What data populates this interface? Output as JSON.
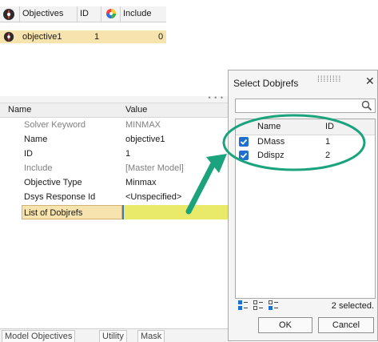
{
  "objectives_table": {
    "headers": [
      "Objectives",
      "ID",
      "Include"
    ],
    "row": {
      "name": "objective1",
      "id": "1",
      "include": "0"
    }
  },
  "property_panel": {
    "col_name": "Name",
    "col_value": "Value",
    "rows": [
      {
        "key": "Solver Keyword",
        "value": "MINMAX"
      },
      {
        "key": "Name",
        "value": "objective1"
      },
      {
        "key": "ID",
        "value": "1"
      },
      {
        "key": "Include",
        "value": "[Master Model]"
      },
      {
        "key": "Objective Type",
        "value": "Minmax"
      },
      {
        "key": "Dsys Response Id",
        "value": "<Unspecified>"
      },
      {
        "key": "List of Dobjrefs",
        "value": ""
      }
    ],
    "tabs": [
      "Model   Objectives",
      "Utility",
      "Mask"
    ]
  },
  "dialog": {
    "title": "Select Dobjrefs",
    "search": {
      "value": "",
      "placeholder": ""
    },
    "columns": {
      "name": "Name",
      "id": "ID"
    },
    "items": [
      {
        "name": "DMass",
        "id": "1",
        "checked": true
      },
      {
        "name": "Ddispz",
        "id": "2",
        "checked": true
      }
    ],
    "selected_text": "2 selected.",
    "ok_label": "OK",
    "cancel_label": "Cancel"
  },
  "annotation_colors": {
    "arrow": "#1aa37c",
    "ellipse": "#1aa37c"
  }
}
